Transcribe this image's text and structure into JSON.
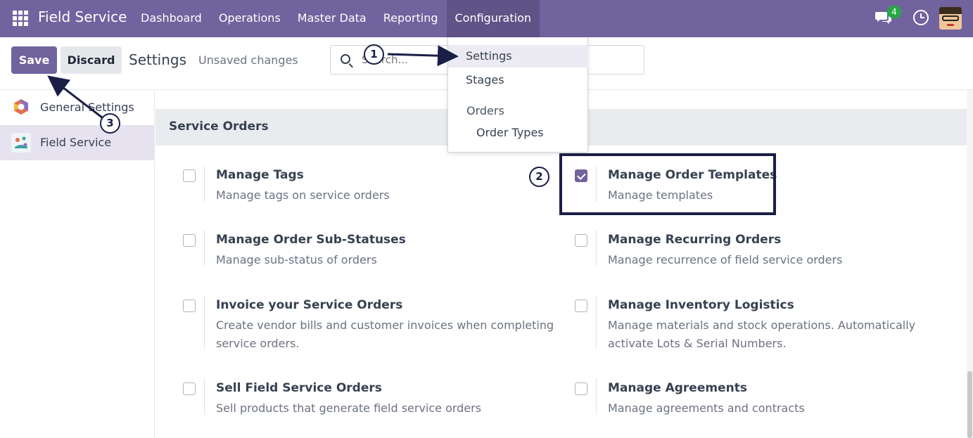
{
  "navbar": {
    "app_name": "Field Service",
    "menu": [
      "Dashboard",
      "Operations",
      "Master Data",
      "Reporting",
      "Configuration"
    ],
    "active_menu": "Configuration",
    "chat_count": "4",
    "icons": [
      "apps-grid-icon",
      "chat-icon",
      "clock-icon",
      "user-avatar"
    ],
    "accent_color": "#71639e"
  },
  "control_panel": {
    "save_label": "Save",
    "discard_label": "Discard",
    "breadcrumb": "Settings",
    "status": "Unsaved changes",
    "search_placeholder": "Search..."
  },
  "sidebar": {
    "items": [
      {
        "label": "General Settings",
        "icon": "general-settings-icon",
        "active": false
      },
      {
        "label": "Field Service",
        "icon": "field-service-icon",
        "active": true
      }
    ]
  },
  "dropdown": {
    "items": [
      "Settings",
      "Stages"
    ],
    "section_header": "Orders",
    "sub_items": [
      "Order Types"
    ],
    "highlighted": "Settings"
  },
  "section": {
    "title": "Service Orders",
    "settings": [
      {
        "title": "Manage Tags",
        "description": "Manage tags on service orders",
        "checked": false
      },
      {
        "title": "Manage Order Templates",
        "description": "Manage templates",
        "checked": true
      },
      {
        "title": "Manage Order Sub-Statuses",
        "description": "Manage sub-status of orders",
        "checked": false
      },
      {
        "title": "Manage Recurring Orders",
        "description": "Manage recurrence of field service orders",
        "checked": false
      },
      {
        "title": "Invoice your Service Orders",
        "description": "Create vendor bills and customer invoices when completing service orders.",
        "checked": false
      },
      {
        "title": "Manage Inventory Logistics",
        "description": "Manage materials and stock operations. Automatically activate Lots & Serial Numbers.",
        "checked": false
      },
      {
        "title": "Sell Field Service Orders",
        "description": "Sell products that generate field service orders",
        "checked": false
      },
      {
        "title": "Manage Agreements",
        "description": "Manage agreements and contracts",
        "checked": false
      }
    ]
  },
  "annotations": {
    "steps": [
      "1",
      "2",
      "3"
    ],
    "color": "#1b1e46"
  }
}
